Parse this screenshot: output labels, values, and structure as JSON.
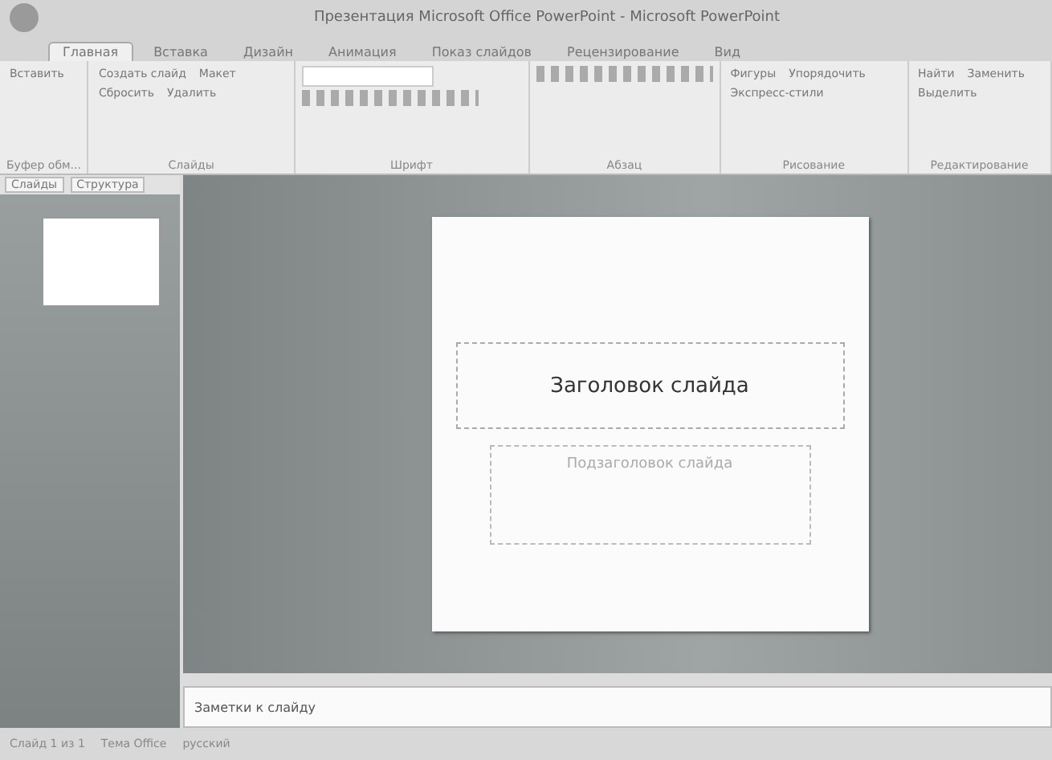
{
  "window": {
    "title": "Презентация Microsoft Office PowerPoint - Microsoft PowerPoint"
  },
  "tabs": [
    {
      "label": "Главная",
      "selected": true
    },
    {
      "label": "Вставка",
      "selected": false
    },
    {
      "label": "Дизайн",
      "selected": false
    },
    {
      "label": "Анимация",
      "selected": false
    },
    {
      "label": "Показ слайдов",
      "selected": false
    },
    {
      "label": "Рецензирование",
      "selected": false
    },
    {
      "label": "Вид",
      "selected": false
    }
  ],
  "ribbon": {
    "groups": [
      {
        "label": "Буфер обм...",
        "buttons": [
          "Вставить"
        ]
      },
      {
        "label": "Слайды",
        "buttons": [
          "Создать слайд",
          "Макет",
          "Сбросить",
          "Удалить"
        ]
      },
      {
        "label": "Шрифт"
      },
      {
        "label": "Абзац"
      },
      {
        "label": "Рисование",
        "buttons": [
          "Фигуры",
          "Упорядочить",
          "Экспресс-стили"
        ]
      },
      {
        "label": "Редактирование",
        "buttons": [
          "Найти",
          "Заменить",
          "Выделить"
        ]
      }
    ]
  },
  "pane_tabs": [
    "Слайды",
    "Структура"
  ],
  "slide": {
    "title": "Заголовок слайда",
    "subtitle": "Подзаголовок слайда"
  },
  "notes": {
    "placeholder": "Заметки к слайду"
  },
  "status_bar": {
    "items": [
      "Слайд 1 из 1",
      "Тема Office",
      "русский"
    ]
  }
}
